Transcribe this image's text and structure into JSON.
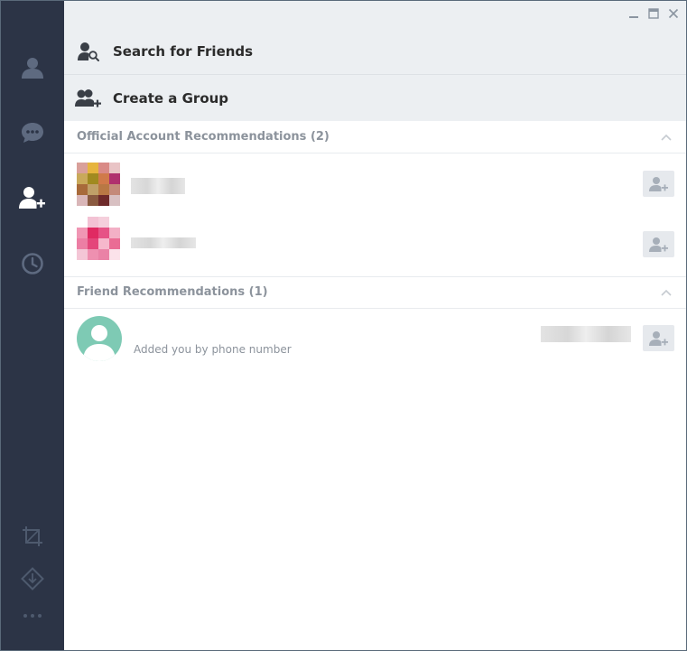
{
  "actions": {
    "search_friends": "Search for Friends",
    "create_group": "Create a Group"
  },
  "sections": {
    "official": {
      "title": "Official Account Recommendations (2)"
    },
    "friends": {
      "title": "Friend Recommendations (1)",
      "items": [
        {
          "subtitle": "Added you by phone number"
        }
      ]
    }
  },
  "icons": {
    "sidebar": [
      "profile-icon",
      "chat-icon",
      "add-friend-icon",
      "history-icon",
      "screenshot-icon",
      "download-icon",
      "more-icon"
    ],
    "window": [
      "minimize-icon",
      "maximize-icon",
      "close-icon"
    ]
  },
  "colors": {
    "sidebar_bg": "#2c3446",
    "sidebar_icon": "#5e6a80",
    "sidebar_icon_active": "#ffffff",
    "header_bg": "#eceff2",
    "section_title": "#8c939c",
    "avatar_default": "#7ecab4"
  }
}
